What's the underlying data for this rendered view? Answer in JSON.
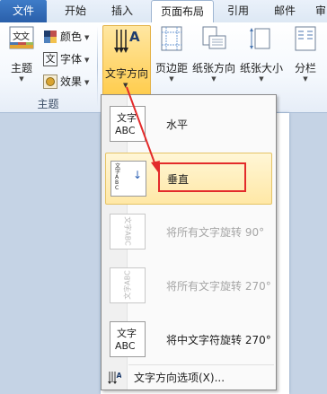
{
  "tabs": [
    {
      "label": "文件"
    },
    {
      "label": "开始"
    },
    {
      "label": "插入"
    },
    {
      "label": "页面布局"
    },
    {
      "label": "引用"
    },
    {
      "label": "邮件"
    },
    {
      "label": "审"
    }
  ],
  "ribbon": {
    "theme_group_label": "主题",
    "theme_button_label": "主题",
    "theme_icon_text": "文文",
    "colors_label": "颜色",
    "fonts_label": "字体",
    "effects_label": "效果",
    "fonts_icon_text": "文",
    "text_direction_label": "文字方向",
    "margins_label": "页边距",
    "orientation_label": "纸张方向",
    "size_label": "纸张大小",
    "columns_label": "分栏",
    "direction_icon_text": "A"
  },
  "menu": {
    "items": [
      {
        "label": "水平",
        "thumb_top": "文字",
        "thumb_bottom": "ABC",
        "enabled": true
      },
      {
        "label": "垂直",
        "thumb_text": "文字ABC",
        "enabled": true,
        "selected": true
      },
      {
        "label": "将所有文字旋转 90°",
        "thumb_text": "文字ABC",
        "enabled": false
      },
      {
        "label": "将所有文字旋转 270°",
        "thumb_text": "文字ABC",
        "enabled": false
      },
      {
        "label": "将中文字符旋转 270°",
        "thumb_top": "文字",
        "thumb_bottom": "ABC",
        "enabled": true
      }
    ],
    "footer_label": "文字方向选项(X)..."
  },
  "colors": {
    "accent": "#e32b2b",
    "highlight": "#ffd56a"
  }
}
